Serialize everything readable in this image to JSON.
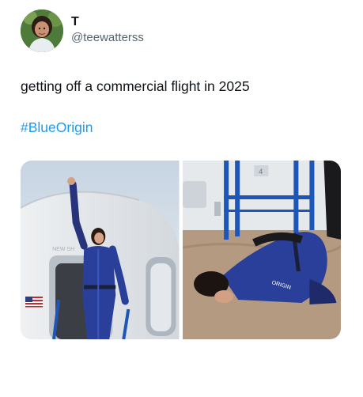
{
  "tweet": {
    "display_name": "T",
    "handle": "@teewatterss",
    "text": "getting off a commercial flight in 2025",
    "hashtag": "#BlueOrigin"
  },
  "media": {
    "photos": [
      {
        "subject": "astronaut-waving-at-capsule-hatch",
        "capsule_text": "NEW SH",
        "flag_icon": "us-flag-icon"
      },
      {
        "subject": "astronaut-kneeling-kissing-ground",
        "suit_text": "ORIGIN",
        "panel_text": "4"
      }
    ]
  },
  "colors": {
    "hashtag": "#1d9bf0",
    "handle": "#536471",
    "suit_blue": "#2a3f9a",
    "rail_blue": "#1e56b8"
  }
}
